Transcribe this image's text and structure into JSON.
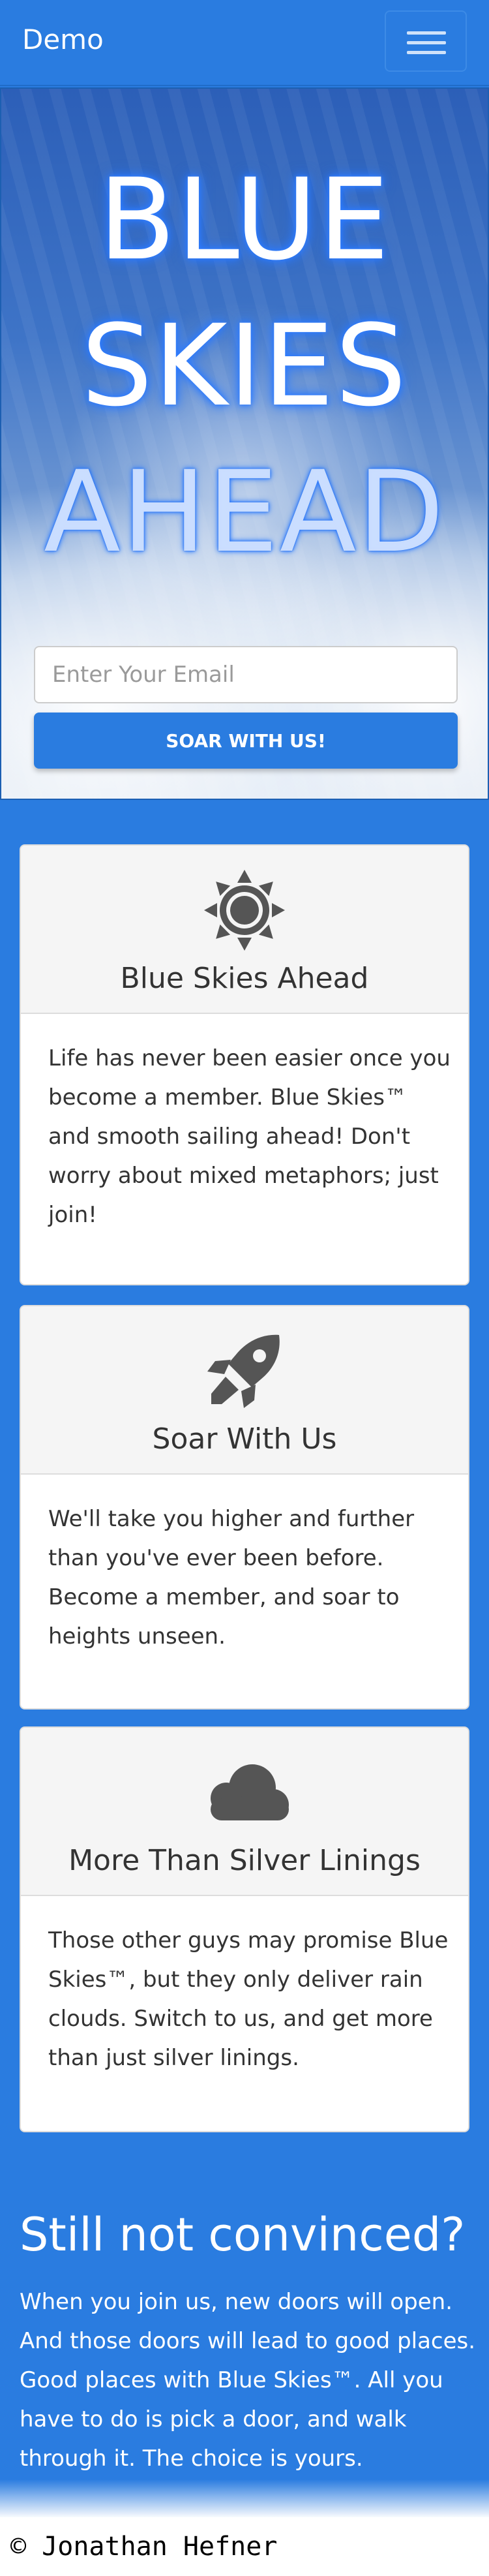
{
  "navbar": {
    "brand": "Demo",
    "menu_icon": "hamburger-menu-icon"
  },
  "hero": {
    "line1": "BLUE",
    "line2": "SKIES",
    "line3": "AHEAD",
    "email_placeholder": "Enter Your Email",
    "button_label": "SOAR WITH US!"
  },
  "cards": [
    {
      "icon": "sun-icon",
      "title": "Blue Skies Ahead",
      "body": "Life has never been easier once you become a member. Blue Skies™ and smooth sailing ahead! Don't worry about mixed metaphors; just join!"
    },
    {
      "icon": "rocket-icon",
      "title": "Soar With Us",
      "body": "We'll take you higher and further than you've ever been before. Become a member, and soar to heights unseen."
    },
    {
      "icon": "cloud-icon",
      "title": "More Than Silver Linings",
      "body": "Those other guys may promise Blue Skies™, but they only deliver rain clouds. Switch to us, and get more than just silver linings."
    }
  ],
  "closing": {
    "title": "Still not convinced?",
    "text": "When you join us, new doors will open. And those doors will lead to good places. Good places with Blue Skies™. All you have to do is pick a door, and walk through it. The choice is yours."
  },
  "footer": {
    "copyright": "© Jonathan Hefner"
  },
  "colors": {
    "primary": "#2a7ce0",
    "card_header": "#f5f5f5",
    "icon": "#555555",
    "text_dark": "#333333"
  }
}
